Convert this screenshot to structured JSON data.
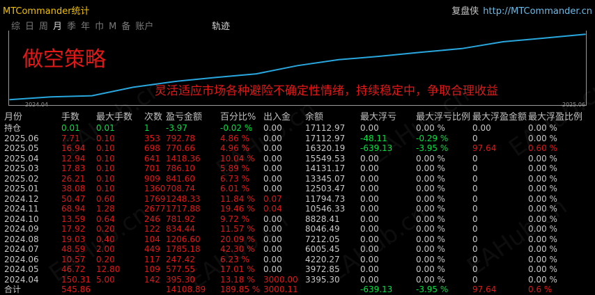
{
  "window": {
    "app_title": "MTCommander统计",
    "brand_name": "复盘侠",
    "brand_url": "http://MTCommander.cn"
  },
  "period_tabs": [
    "综",
    "日",
    "周",
    "月",
    "季",
    "年",
    "巾",
    "M",
    "备",
    "账户"
  ],
  "period_tabs_active_index": 3,
  "track_tab": "轨迹",
  "strategy": {
    "title": "做空策略",
    "description": "灵活适应市场各种避险不确定性情绪，持续稳定中，争取合理收益"
  },
  "colors": {
    "up": "#00e040",
    "down": "#e01818",
    "neutral": "#c8c8c8",
    "accent_title": "#f0c000",
    "curve": "#29a8e0",
    "frame": "#9a9a9a"
  },
  "chart_data": {
    "type": "line",
    "xlabel_start": "2024.04",
    "xlabel_end": "2025.06",
    "x": [
      "2024.04",
      "2024.05",
      "2024.06",
      "2024.07",
      "2024.08",
      "2024.09",
      "2024.10",
      "2024.11",
      "2024.12",
      "2025.01",
      "2025.02",
      "2025.03",
      "2025.04",
      "2025.05",
      "2025.06"
    ],
    "values": [
      3395.3,
      3972.85,
      4220.27,
      6005.45,
      7212.05,
      8046.49,
      8828.41,
      10546.33,
      11794.73,
      12503.47,
      13345.07,
      14131.17,
      15549.53,
      16320.19,
      17112.97
    ],
    "ylim": [
      3000,
      17600
    ]
  },
  "watermark": "EAHub.cn",
  "table": {
    "headers": [
      "月份",
      "手数",
      "最大手数",
      "次数",
      "盈亏金额",
      "百分比%",
      "出入金",
      "余额",
      "最大浮亏",
      "最大浮亏比例",
      "最大浮盈金额",
      "最大浮盈比例"
    ],
    "rows": [
      {
        "cells": [
          "持仓",
          "0.01",
          "0.01",
          "1",
          "-3.97",
          "-0.02 %",
          "0.00",
          "17112.97",
          "0.00",
          "0.00 %",
          "0.00",
          "0.00 %"
        ],
        "colors": [
          "n",
          "u",
          "u",
          "u",
          "u",
          "u",
          "n",
          "n",
          "n",
          "n",
          "n",
          "n"
        ]
      },
      {
        "cells": [
          "2025.06",
          "7.71",
          "0.10",
          "353",
          "792.78",
          "4.86 %",
          "0.00",
          "17112.97",
          "-48.11",
          "-0.29 %",
          "0",
          "0.00 %"
        ],
        "colors": [
          "n",
          "d",
          "d",
          "d",
          "d",
          "d",
          "n",
          "n",
          "u",
          "u",
          "n",
          "n"
        ]
      },
      {
        "cells": [
          "2025.05",
          "16.94",
          "0.10",
          "698",
          "770.66",
          "4.96 %",
          "0.00",
          "16320.19",
          "-639.13",
          "-3.95 %",
          "97.64",
          "0.60 %"
        ],
        "colors": [
          "n",
          "d",
          "d",
          "d",
          "d",
          "d",
          "n",
          "n",
          "u",
          "u",
          "d",
          "d"
        ]
      },
      {
        "cells": [
          "2025.04",
          "12.94",
          "0.10",
          "641",
          "1418.36",
          "10.04 %",
          "0.00",
          "15549.53",
          "0.00",
          "0.00 %",
          "0",
          "0.00 %"
        ],
        "colors": [
          "n",
          "d",
          "d",
          "d",
          "d",
          "d",
          "n",
          "n",
          "n",
          "n",
          "n",
          "n"
        ]
      },
      {
        "cells": [
          "2025.03",
          "17.83",
          "0.10",
          "701",
          "786.10",
          "5.89 %",
          "0.00",
          "14131.17",
          "0.00",
          "0.00 %",
          "0",
          "0.00 %"
        ],
        "colors": [
          "n",
          "d",
          "d",
          "d",
          "d",
          "d",
          "n",
          "n",
          "n",
          "n",
          "n",
          "n"
        ]
      },
      {
        "cells": [
          "2025.02",
          "26.21",
          "0.10",
          "909",
          "841.60",
          "6.73 %",
          "0.00",
          "13345.07",
          "0.00",
          "0.00 %",
          "0",
          "0.00 %"
        ],
        "colors": [
          "n",
          "d",
          "d",
          "d",
          "d",
          "d",
          "n",
          "n",
          "n",
          "n",
          "n",
          "n"
        ]
      },
      {
        "cells": [
          "2025.01",
          "38.08",
          "0.10",
          "1360",
          "708.74",
          "6.01 %",
          "0.00",
          "12503.47",
          "0.00",
          "0.00 %",
          "0",
          "0.00 %"
        ],
        "colors": [
          "n",
          "d",
          "d",
          "d",
          "d",
          "d",
          "n",
          "n",
          "n",
          "n",
          "n",
          "n"
        ]
      },
      {
        "cells": [
          "2024.12",
          "50.47",
          "0.60",
          "1769",
          "1248.33",
          "11.84 %",
          "0.07",
          "11794.73",
          "0.00",
          "0.00 %",
          "0",
          "0.00 %"
        ],
        "colors": [
          "n",
          "d",
          "d",
          "d",
          "d",
          "d",
          "d",
          "n",
          "n",
          "n",
          "n",
          "n"
        ]
      },
      {
        "cells": [
          "2024.11",
          "68.94",
          "1.28",
          "2677",
          "1717.88",
          "19.46 %",
          "0.04",
          "10546.33",
          "0.00",
          "0.00 %",
          "0",
          "0.00 %"
        ],
        "colors": [
          "n",
          "d",
          "d",
          "d",
          "d",
          "d",
          "d",
          "n",
          "n",
          "n",
          "n",
          "n"
        ]
      },
      {
        "cells": [
          "2024.10",
          "13.59",
          "0.64",
          "246",
          "781.92",
          "9.72 %",
          "0.00",
          "8828.41",
          "0.00",
          "0.00 %",
          "0",
          "0.00 %"
        ],
        "colors": [
          "n",
          "d",
          "d",
          "d",
          "d",
          "d",
          "n",
          "n",
          "n",
          "n",
          "n",
          "n"
        ]
      },
      {
        "cells": [
          "2024.09",
          "17.92",
          "0.20",
          "122",
          "834.44",
          "11.57 %",
          "0.00",
          "8046.49",
          "0.00",
          "0.00 %",
          "0",
          "0.00 %"
        ],
        "colors": [
          "n",
          "d",
          "d",
          "d",
          "d",
          "d",
          "n",
          "n",
          "n",
          "n",
          "n",
          "n"
        ]
      },
      {
        "cells": [
          "2024.08",
          "19.03",
          "0.40",
          "104",
          "1206.60",
          "20.09 %",
          "0.00",
          "7212.05",
          "0.00",
          "0.00 %",
          "0",
          "0.00 %"
        ],
        "colors": [
          "n",
          "d",
          "d",
          "d",
          "d",
          "d",
          "n",
          "n",
          "n",
          "n",
          "n",
          "n"
        ]
      },
      {
        "cells": [
          "2024.07",
          "48.59",
          "2.00",
          "449",
          "1785.18",
          "42.30 %",
          "0.00",
          "6005.45",
          "0.00",
          "0.00 %",
          "0",
          "0.00 %"
        ],
        "colors": [
          "n",
          "d",
          "d",
          "d",
          "d",
          "d",
          "n",
          "n",
          "n",
          "n",
          "n",
          "n"
        ]
      },
      {
        "cells": [
          "2024.06",
          "10.57",
          "0.20",
          "117",
          "247.42",
          "6.23 %",
          "0.00",
          "4220.27",
          "0.00",
          "0.00 %",
          "0",
          "0.00 %"
        ],
        "colors": [
          "n",
          "d",
          "d",
          "d",
          "d",
          "d",
          "n",
          "n",
          "n",
          "n",
          "n",
          "n"
        ]
      },
      {
        "cells": [
          "2024.05",
          "46.72",
          "12.80",
          "109",
          "577.55",
          "17.01 %",
          "0.00",
          "3972.85",
          "0.00",
          "0.00 %",
          "0",
          "0.00 %"
        ],
        "colors": [
          "n",
          "d",
          "d",
          "d",
          "d",
          "d",
          "n",
          "n",
          "n",
          "n",
          "n",
          "n"
        ]
      },
      {
        "cells": [
          "2024.04",
          "150.31",
          "5.00",
          "142",
          "395.30",
          "13.18 %",
          "3000.00",
          "3395.30",
          "0.00",
          "0.00 %",
          "0",
          "0.00 %"
        ],
        "colors": [
          "n",
          "d",
          "d",
          "d",
          "d",
          "d",
          "d",
          "n",
          "n",
          "n",
          "n",
          "n"
        ]
      },
      {
        "cells": [
          "合计",
          "545.86",
          "",
          "",
          "14108.89",
          "189.85 %",
          "3000.11",
          "",
          "-639.13",
          "-3.95 %",
          "97.64",
          "0.6 %"
        ],
        "colors": [
          "n",
          "d",
          "d",
          "d",
          "d",
          "d",
          "d",
          "n",
          "u",
          "u",
          "d",
          "d"
        ]
      }
    ]
  }
}
